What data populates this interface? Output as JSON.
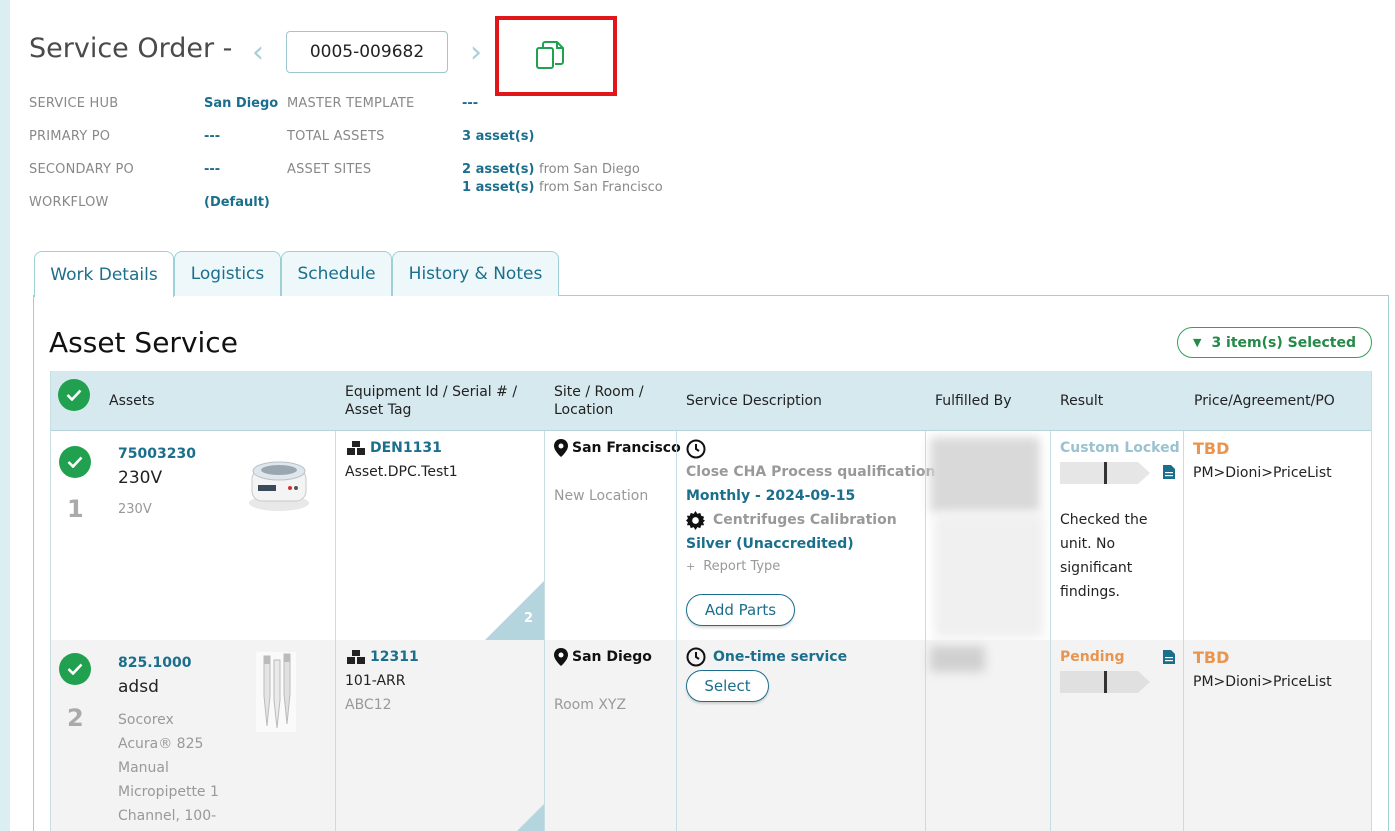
{
  "header": {
    "title": "Service Order -",
    "order_number": "0005-009682",
    "prev_icon": "chevron-left-icon",
    "next_icon": "chevron-right-icon",
    "copy_icon": "copy-icon"
  },
  "meta": {
    "service_hub_label": "SERVICE HUB",
    "service_hub_value": "San Diego",
    "primary_po_label": "PRIMARY PO",
    "primary_po_value": "---",
    "secondary_po_label": "SECONDARY PO",
    "secondary_po_value": "---",
    "workflow_label": "WORKFLOW",
    "workflow_value": "(Default)",
    "master_template_label": "MASTER TEMPLATE",
    "master_template_value": "---",
    "total_assets_label": "TOTAL ASSETS",
    "total_assets_value": "3 asset(s)",
    "asset_sites_label": "ASSET SITES",
    "asset_sites": [
      {
        "count": "2 asset(s)",
        "from": "from San Diego"
      },
      {
        "count": "1 asset(s)",
        "from": "from San Francisco"
      }
    ]
  },
  "tabs": [
    {
      "label": "Work Details",
      "active": true
    },
    {
      "label": "Logistics",
      "active": false
    },
    {
      "label": "Schedule",
      "active": false
    },
    {
      "label": "History & Notes",
      "active": false
    }
  ],
  "section": {
    "title": "Asset Service",
    "selected_label": "3 item(s) Selected"
  },
  "table": {
    "columns": [
      "Assets",
      "Equipment Id / Serial # / Asset Tag",
      "Site / Room / Location",
      "Service Description",
      "Fulfilled By",
      "Result",
      "Price/Agreement/PO"
    ],
    "rows": [
      {
        "index": "1",
        "asset_id": "75003230",
        "asset_name": "230V",
        "asset_desc": "230V",
        "equipment_id": "DEN1131",
        "serial": "Asset.DPC.Test1",
        "tag": "",
        "corner_count": "2",
        "site": "San Francisco",
        "location": "New Location",
        "service_line1": "Close CHA Process qualification",
        "service_line2": "Monthly - 2024-09-15",
        "service_line3": "Centrifuges Calibration",
        "service_line4": "Silver (Unaccredited)",
        "service_line5": "Report Type",
        "service_button": "Add Parts",
        "result_status": "Custom Locked",
        "result_note": "Checked the unit. No significant findings.",
        "price": "TBD",
        "agreement": "PM>Dioni>PriceList"
      },
      {
        "index": "2",
        "asset_id": "825.1000",
        "asset_name": "adsd",
        "asset_desc": "Socorex Acura® 825 Manual Micropipette 1 Channel, 100-",
        "equipment_id": "12311",
        "serial": "101-ARR",
        "tag": "ABC12",
        "site": "San Diego",
        "location": "Room XYZ",
        "service_line1": "One-time service",
        "service_button": "Select",
        "result_status": "Pending",
        "price": "TBD",
        "agreement": "PM>Dioni>PriceList"
      }
    ]
  }
}
